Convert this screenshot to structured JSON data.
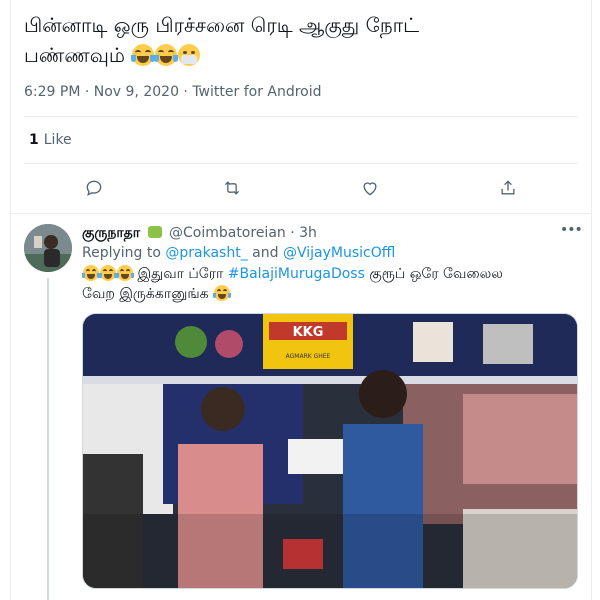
{
  "tweet": {
    "text_line1": "பின்னாடி ஒரு பிரச்சனை ரெடி ஆகுது நோட்",
    "text_line2": "பண்ணவும்",
    "emojis": [
      "laughing-crying-emoji",
      "laughing-crying-emoji",
      "mask-emoji"
    ],
    "meta": "6:29 PM · Nov 9, 2020 · Twitter for Android",
    "like_count": "1",
    "like_label": "Like",
    "actions": [
      "reply-icon",
      "retweet-icon",
      "like-icon",
      "share-icon"
    ]
  },
  "reply": {
    "display_name": "குருநாதா",
    "handle": "@Coimbatoreian",
    "time": "3h",
    "more": "•••",
    "replying_prefix": "Replying to",
    "replying_user1": "@prakasht_",
    "replying_and": "and",
    "replying_user2": "@VijayMusicOffl",
    "text_part1": "இதுவா ப்ரோ",
    "hashtag": "#BalajiMurugaDoss",
    "text_part2": "குரூப் ஒரே வேலைல",
    "text_line2": "வேற இருக்கானுங்க",
    "media": "video-still-kitchen-scene",
    "jar_label": "KKG",
    "jar_sublabel": "AGMARK GHEE"
  },
  "colors": {
    "link": "#1b95e0",
    "text": "#0f1419",
    "secondary": "#536471",
    "border": "#ebeef0"
  }
}
